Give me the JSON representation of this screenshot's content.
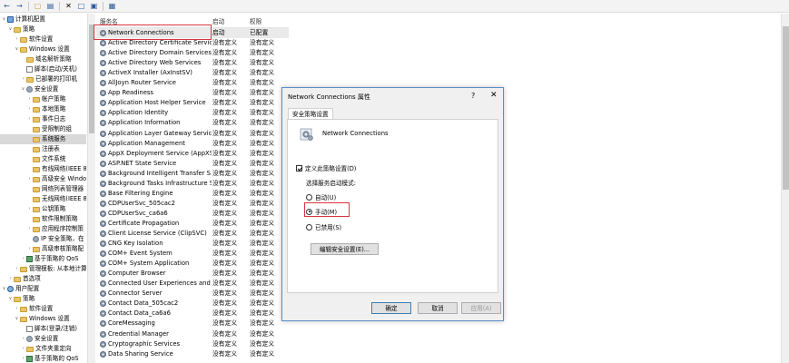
{
  "toolbar": {
    "icons": [
      "back-arrow",
      "forward-arrow",
      "folder-up",
      "list",
      "delete",
      "properties",
      "help",
      "view"
    ]
  },
  "tree": [
    {
      "label": "计算机配置",
      "indent": 0,
      "exp": "v",
      "icon": "computer"
    },
    {
      "label": "策略",
      "indent": 1,
      "exp": "v",
      "icon": "folder"
    },
    {
      "label": "软件设置",
      "indent": 2,
      "exp": ">",
      "icon": "folder"
    },
    {
      "label": "Windows 设置",
      "indent": 2,
      "exp": "v",
      "icon": "folder"
    },
    {
      "label": "域名解析策略",
      "indent": 3,
      "exp": "",
      "icon": "folder"
    },
    {
      "label": "脚本(启动/关机)",
      "indent": 3,
      "exp": "",
      "icon": "doc"
    },
    {
      "label": "已部署的打印机",
      "indent": 3,
      "exp": ">",
      "icon": "folder"
    },
    {
      "label": "安全设置",
      "indent": 3,
      "exp": "v",
      "icon": "shield"
    },
    {
      "label": "帐户策略",
      "indent": 4,
      "exp": ">",
      "icon": "folder"
    },
    {
      "label": "本地策略",
      "indent": 4,
      "exp": ">",
      "icon": "folder"
    },
    {
      "label": "事件日志",
      "indent": 4,
      "exp": ">",
      "icon": "folder"
    },
    {
      "label": "受限制的组",
      "indent": 4,
      "exp": "",
      "icon": "folder"
    },
    {
      "label": "系统服务",
      "indent": 4,
      "exp": "",
      "icon": "folder",
      "selected": true
    },
    {
      "label": "注册表",
      "indent": 4,
      "exp": "",
      "icon": "folder"
    },
    {
      "label": "文件系统",
      "indent": 4,
      "exp": "",
      "icon": "folder"
    },
    {
      "label": "有线网络(IEEE 8",
      "indent": 4,
      "exp": "",
      "icon": "folder"
    },
    {
      "label": "高级安全 Windo",
      "indent": 4,
      "exp": ">",
      "icon": "folder"
    },
    {
      "label": "网络列表管理器",
      "indent": 4,
      "exp": "",
      "icon": "folder"
    },
    {
      "label": "无线网络(IEEE 8",
      "indent": 4,
      "exp": "",
      "icon": "folder"
    },
    {
      "label": "公钥策略",
      "indent": 4,
      "exp": ">",
      "icon": "folder"
    },
    {
      "label": "软件限制策略",
      "indent": 4,
      "exp": "",
      "icon": "folder"
    },
    {
      "label": "应用程序控制策",
      "indent": 4,
      "exp": ">",
      "icon": "folder"
    },
    {
      "label": "IP 安全策略，在",
      "indent": 4,
      "exp": "",
      "icon": "shield"
    },
    {
      "label": "高级审核策略配",
      "indent": 4,
      "exp": ">",
      "icon": "folder"
    },
    {
      "label": "基于策略的 QoS",
      "indent": 3,
      "exp": ">",
      "icon": "chart"
    },
    {
      "label": "管理模板: 从本地计算机",
      "indent": 2,
      "exp": ">",
      "icon": "folder"
    },
    {
      "label": "首选项",
      "indent": 1,
      "exp": ">",
      "icon": "folder"
    },
    {
      "label": "用户配置",
      "indent": 0,
      "exp": "v",
      "icon": "user"
    },
    {
      "label": "策略",
      "indent": 1,
      "exp": "v",
      "icon": "folder"
    },
    {
      "label": "软件设置",
      "indent": 2,
      "exp": ">",
      "icon": "folder"
    },
    {
      "label": "Windows 设置",
      "indent": 2,
      "exp": "v",
      "icon": "folder"
    },
    {
      "label": "脚本(登录/注销)",
      "indent": 3,
      "exp": "",
      "icon": "doc"
    },
    {
      "label": "安全设置",
      "indent": 3,
      "exp": ">",
      "icon": "shield"
    },
    {
      "label": "文件夹重定向",
      "indent": 3,
      "exp": ">",
      "icon": "folder"
    },
    {
      "label": "基于策略的 QoS",
      "indent": 3,
      "exp": ">",
      "icon": "chart"
    }
  ],
  "list": {
    "headers": {
      "name": "服务名",
      "startup": "启动",
      "permission": "权限"
    },
    "rows": [
      {
        "name": "Network Connections",
        "startup": "启动",
        "permission": "已配置"
      },
      {
        "name": "Active Directory Certificate Services",
        "startup": "没有定义",
        "permission": "没有定义"
      },
      {
        "name": "Active Directory Domain Services",
        "startup": "没有定义",
        "permission": "没有定义"
      },
      {
        "name": "Active Directory Web Services",
        "startup": "没有定义",
        "permission": "没有定义"
      },
      {
        "name": "ActiveX Installer (AxInstSV)",
        "startup": "没有定义",
        "permission": "没有定义"
      },
      {
        "name": "AllJoyn Router Service",
        "startup": "没有定义",
        "permission": "没有定义"
      },
      {
        "name": "App Readiness",
        "startup": "没有定义",
        "permission": "没有定义"
      },
      {
        "name": "Application Host Helper Service",
        "startup": "没有定义",
        "permission": "没有定义"
      },
      {
        "name": "Application Identity",
        "startup": "没有定义",
        "permission": "没有定义"
      },
      {
        "name": "Application Information",
        "startup": "没有定义",
        "permission": "没有定义"
      },
      {
        "name": "Application Layer Gateway Service",
        "startup": "没有定义",
        "permission": "没有定义"
      },
      {
        "name": "Application Management",
        "startup": "没有定义",
        "permission": "没有定义"
      },
      {
        "name": "AppX Deployment Service (AppXS...",
        "startup": "没有定义",
        "permission": "没有定义"
      },
      {
        "name": "ASP.NET State Service",
        "startup": "没有定义",
        "permission": "没有定义"
      },
      {
        "name": "Background Intelligent Transfer S...",
        "startup": "没有定义",
        "permission": "没有定义"
      },
      {
        "name": "Background Tasks Infrastructure S...",
        "startup": "没有定义",
        "permission": "没有定义"
      },
      {
        "name": "Base Filtering Engine",
        "startup": "没有定义",
        "permission": "没有定义"
      },
      {
        "name": "CDPUserSvc_505cac2",
        "startup": "没有定义",
        "permission": "没有定义"
      },
      {
        "name": "CDPUserSvc_ca6a6",
        "startup": "没有定义",
        "permission": "没有定义"
      },
      {
        "name": "Certificate Propagation",
        "startup": "没有定义",
        "permission": "没有定义"
      },
      {
        "name": "Client License Service (ClipSVC)",
        "startup": "没有定义",
        "permission": "没有定义"
      },
      {
        "name": "CNG Key Isolation",
        "startup": "没有定义",
        "permission": "没有定义"
      },
      {
        "name": "COM+ Event System",
        "startup": "没有定义",
        "permission": "没有定义"
      },
      {
        "name": "COM+ System Application",
        "startup": "没有定义",
        "permission": "没有定义"
      },
      {
        "name": "Computer Browser",
        "startup": "没有定义",
        "permission": "没有定义"
      },
      {
        "name": "Connected User Experiences and ...",
        "startup": "没有定义",
        "permission": "没有定义"
      },
      {
        "name": "Connector Server",
        "startup": "没有定义",
        "permission": "没有定义"
      },
      {
        "name": "Contact Data_505cac2",
        "startup": "没有定义",
        "permission": "没有定义"
      },
      {
        "name": "Contact Data_ca6a6",
        "startup": "没有定义",
        "permission": "没有定义"
      },
      {
        "name": "CoreMessaging",
        "startup": "没有定义",
        "permission": "没有定义"
      },
      {
        "name": "Credential Manager",
        "startup": "没有定义",
        "permission": "没有定义"
      },
      {
        "name": "Cryptographic Services",
        "startup": "没有定义",
        "permission": "没有定义"
      },
      {
        "name": "Data Sharing Service",
        "startup": "没有定义",
        "permission": "没有定义"
      }
    ]
  },
  "dialog": {
    "title": "Network Connections 属性",
    "help": "?",
    "close": "✕",
    "tab": "安全策略设置",
    "service_name": "Network Connections",
    "define_checkbox": "定义此策略设置(D)",
    "define_checked": true,
    "mode_label": "选择服务启动模式:",
    "options": [
      {
        "label": "自动(U)",
        "checked": false
      },
      {
        "label": "手动(M)",
        "checked": true
      },
      {
        "label": "已禁用(S)",
        "checked": false
      }
    ],
    "edit_button": "编辑安全设置(E)...",
    "ok": "确定",
    "cancel": "取消",
    "apply": "应用(A)"
  },
  "colors": {
    "highlight_box": "#d9363e",
    "dialog_border": "#5c8cc8",
    "selection": "#d9d9d9"
  }
}
